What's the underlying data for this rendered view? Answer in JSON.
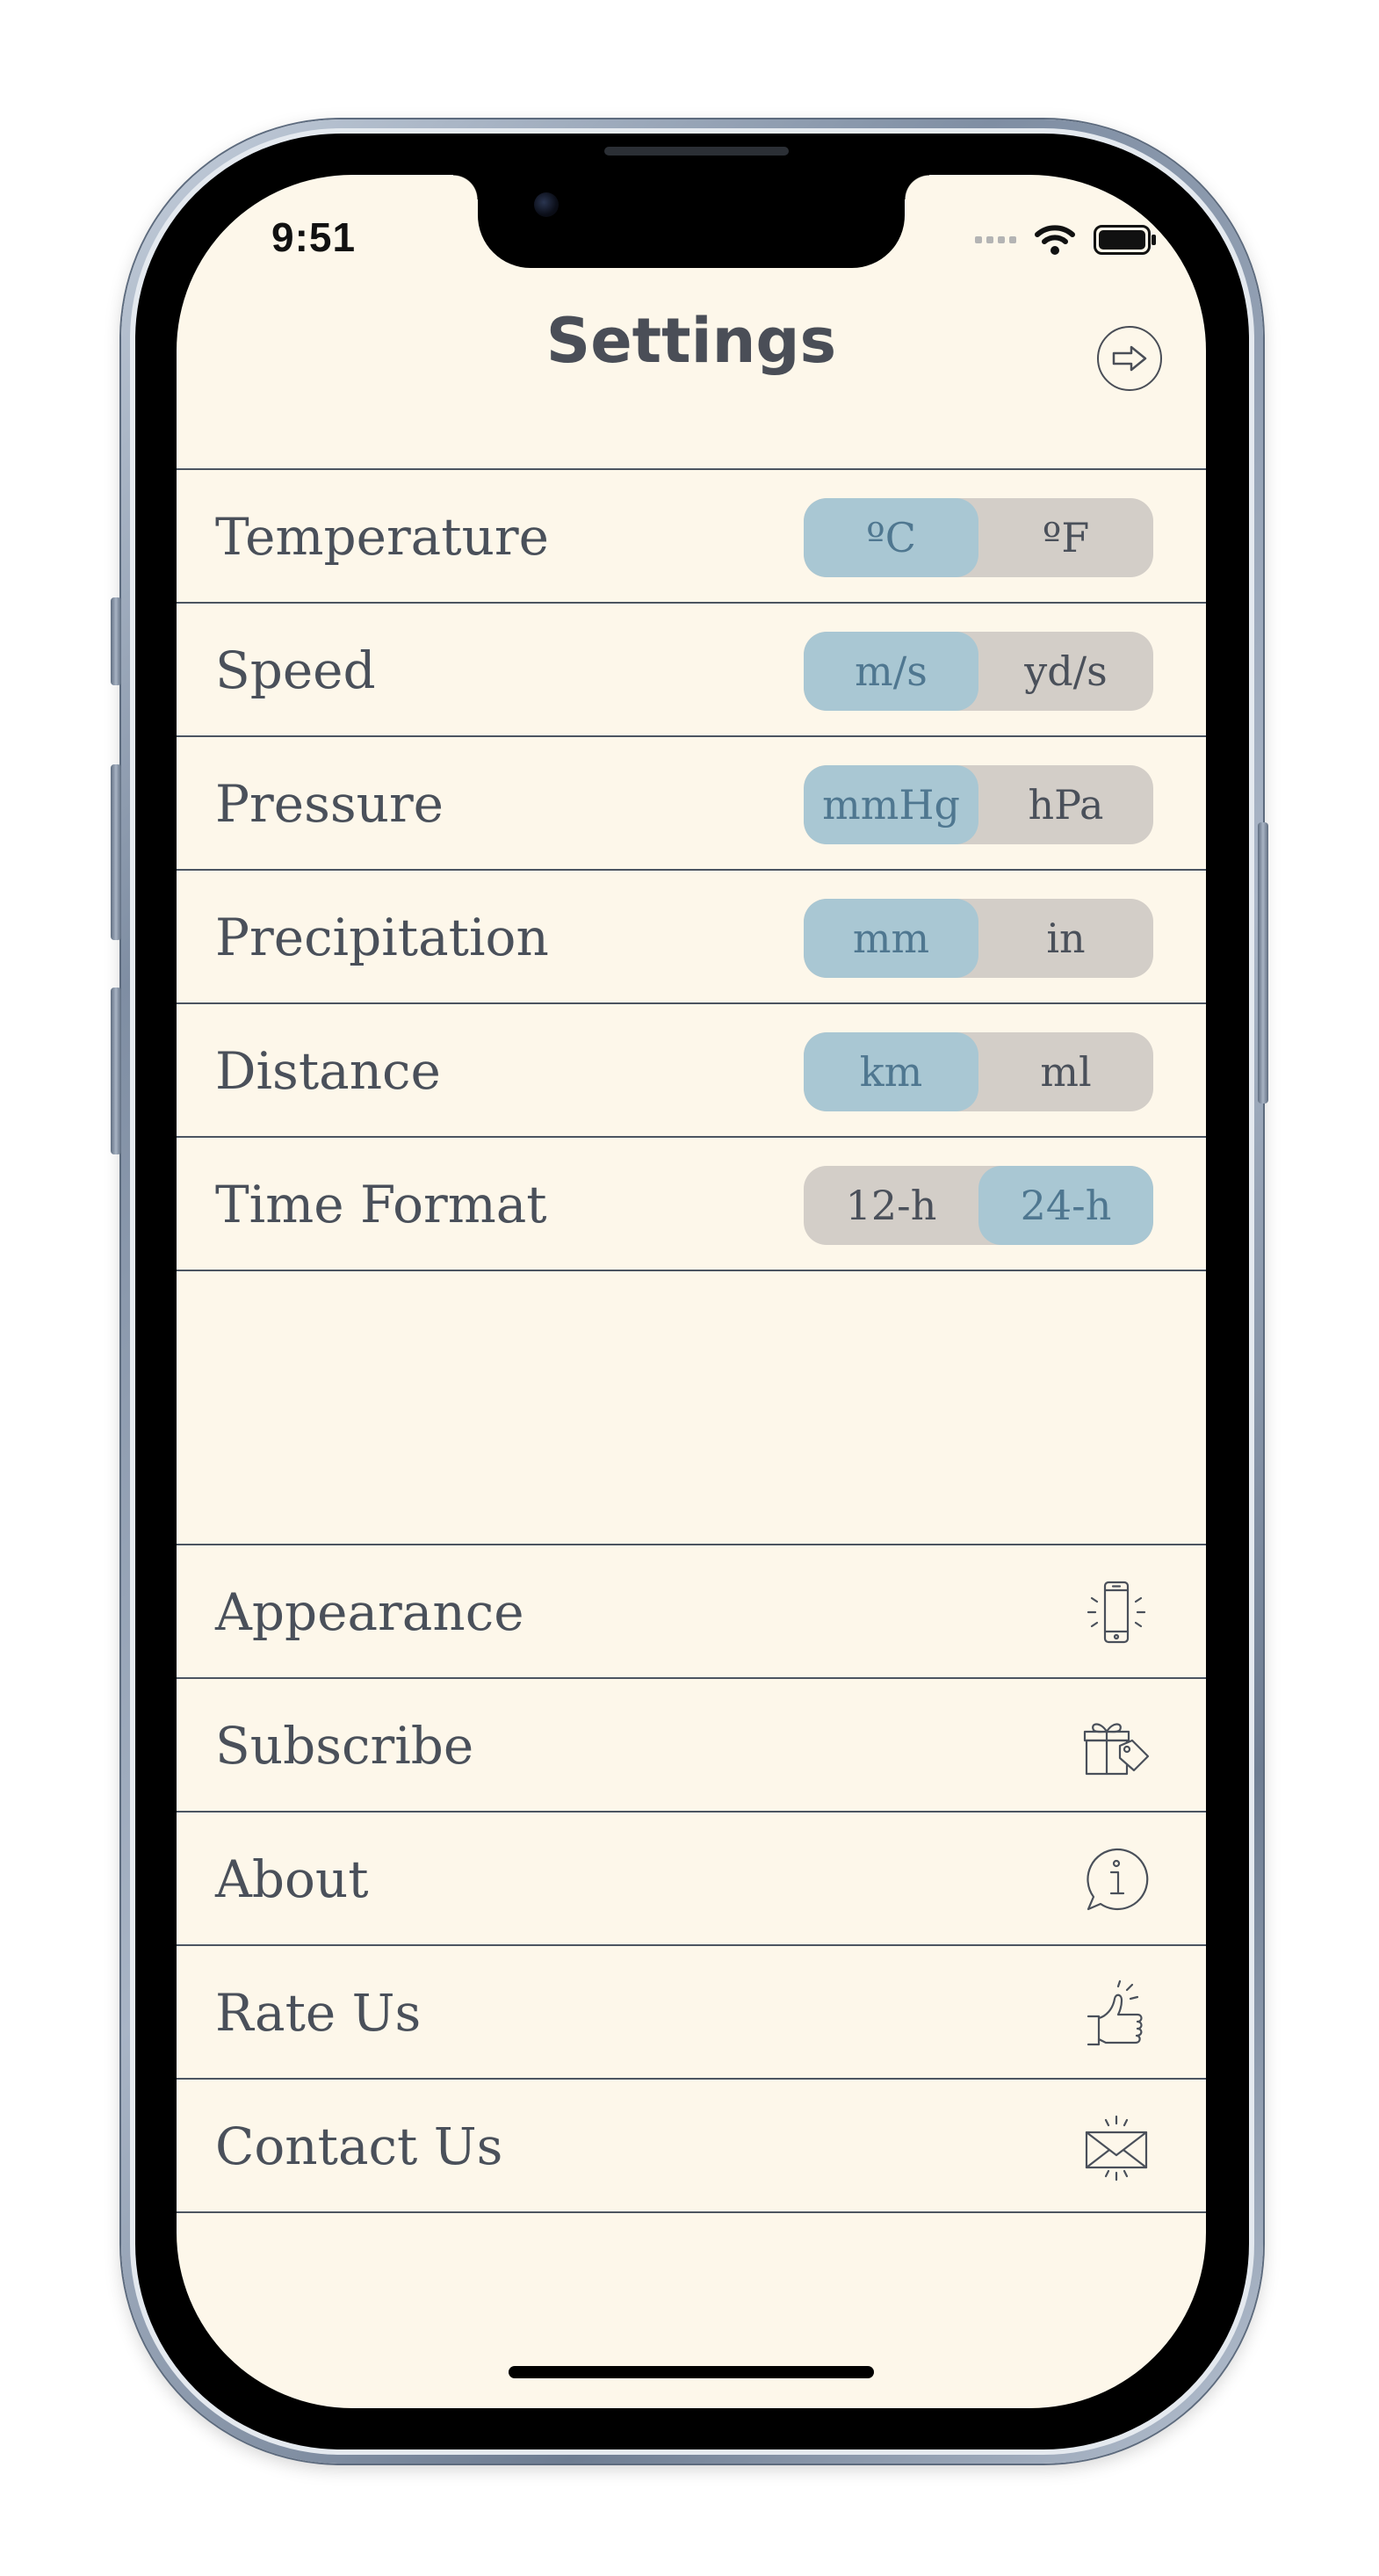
{
  "status_bar": {
    "time": "9:51"
  },
  "header": {
    "title": "Settings"
  },
  "unit_rows": [
    {
      "label": "Temperature",
      "options": [
        "ºC",
        "ºF"
      ],
      "selected": 0
    },
    {
      "label": "Speed",
      "options": [
        "m/s",
        "yd/s"
      ],
      "selected": 0
    },
    {
      "label": "Pressure",
      "options": [
        "mmHg",
        "hPa"
      ],
      "selected": 0
    },
    {
      "label": "Precipitation",
      "options": [
        "mm",
        "in"
      ],
      "selected": 0
    },
    {
      "label": "Distance",
      "options": [
        "km",
        "ml"
      ],
      "selected": 0
    },
    {
      "label": "Time Format",
      "options": [
        "12-h",
        "24-h"
      ],
      "selected": 1
    }
  ],
  "menu_rows": [
    {
      "label": "Appearance",
      "icon": "phone-vibrate-icon"
    },
    {
      "label": "Subscribe",
      "icon": "gift-tag-icon"
    },
    {
      "label": "About",
      "icon": "info-bubble-icon"
    },
    {
      "label": "Rate Us",
      "icon": "thumbs-up-icon"
    },
    {
      "label": "Contact Us",
      "icon": "envelope-icon"
    }
  ],
  "colors": {
    "background": "#fdf7ea",
    "text": "#4a505a",
    "segment_active": "#a9c7d3",
    "segment_active_text": "#4f7790",
    "segment_inactive": "#d3cec8"
  }
}
